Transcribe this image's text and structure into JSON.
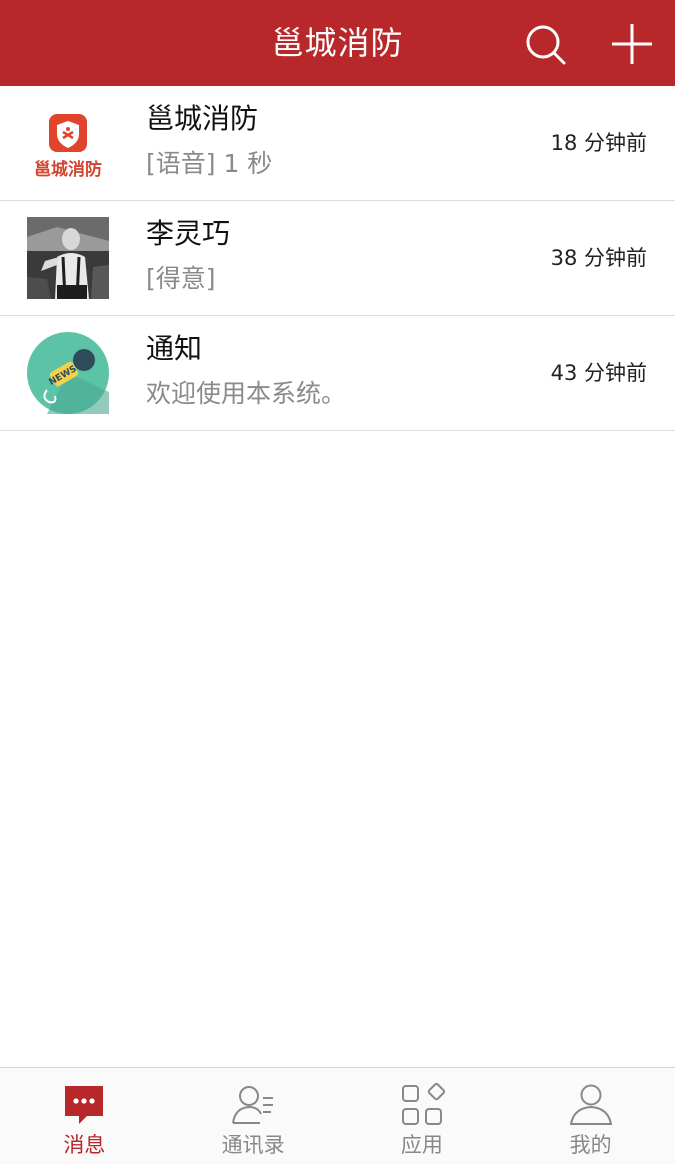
{
  "header": {
    "title": "邕城消防",
    "search_icon": "search-icon",
    "add_icon": "plus-icon"
  },
  "colors": {
    "brand": "#b8282a",
    "tab_inactive": "#888888",
    "preview_text": "#8a8a8a"
  },
  "conversations": [
    {
      "name": "邕城消防",
      "preview": "[语音] 1 秒",
      "time": "18 分钟前",
      "avatar": "fire-department-logo",
      "avatar_text": "邕城消防"
    },
    {
      "name": "李灵巧",
      "preview": "[得意]",
      "time": "38 分钟前",
      "avatar": "user-photo"
    },
    {
      "name": "通知",
      "preview": "欢迎使用本系统。",
      "time": "43 分钟前",
      "avatar": "news-microphone-icon",
      "avatar_text": "NEWS"
    }
  ],
  "tabs": [
    {
      "label": "消息",
      "icon": "chat-bubble-icon",
      "active": true
    },
    {
      "label": "通讯录",
      "icon": "contacts-icon",
      "active": false
    },
    {
      "label": "应用",
      "icon": "apps-grid-icon",
      "active": false
    },
    {
      "label": "我的",
      "icon": "profile-icon",
      "active": false
    }
  ]
}
